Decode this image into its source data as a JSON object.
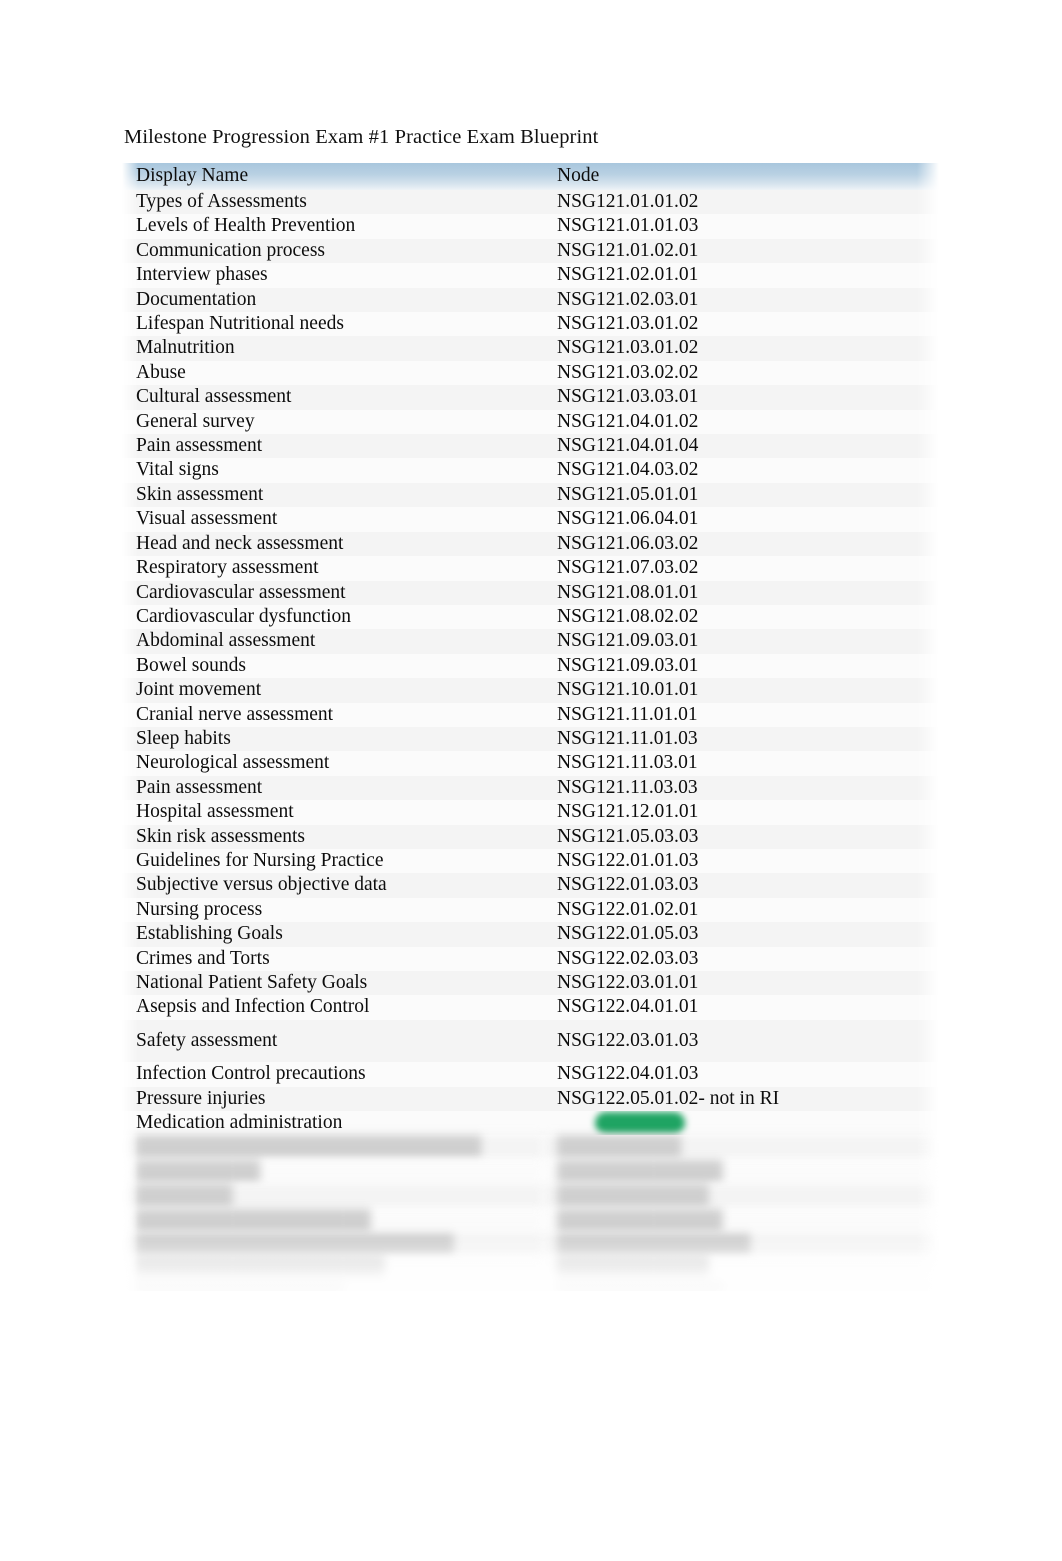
{
  "document": {
    "title": "Milestone Progression Exam #1 Practice Exam Blueprint"
  },
  "table": {
    "columns": [
      "Display Name",
      "Node"
    ],
    "header": {
      "display_name": "Display Name",
      "node": "Node"
    },
    "header_background_color": "#b9d1e3",
    "highlight_color": "#1fa463",
    "rows": [
      {
        "display_name": "Types of Assessments",
        "node": "NSG121.01.01.02",
        "obscured": false
      },
      {
        "display_name": "Levels of Health Prevention",
        "node": "NSG121.01.01.03",
        "obscured": false
      },
      {
        "display_name": "Communication process",
        "node": "NSG121.01.02.01",
        "obscured": false
      },
      {
        "display_name": "Interview phases",
        "node": "NSG121.02.01.01",
        "obscured": false
      },
      {
        "display_name": "Documentation",
        "node": "NSG121.02.03.01",
        "obscured": false
      },
      {
        "display_name": "Lifespan Nutritional needs",
        "node": "NSG121.03.01.02",
        "obscured": false
      },
      {
        "display_name": "Malnutrition",
        "node": "NSG121.03.01.02",
        "obscured": false
      },
      {
        "display_name": "Abuse",
        "node": "NSG121.03.02.02",
        "obscured": false
      },
      {
        "display_name": "Cultural assessment",
        "node": "NSG121.03.03.01",
        "obscured": false
      },
      {
        "display_name": "General survey",
        "node": "NSG121.04.01.02",
        "obscured": false
      },
      {
        "display_name": "Pain assessment",
        "node": "NSG121.04.01.04",
        "obscured": false
      },
      {
        "display_name": "Vital signs",
        "node": "NSG121.04.03.02",
        "obscured": false
      },
      {
        "display_name": "Skin assessment",
        "node": "NSG121.05.01.01",
        "obscured": false
      },
      {
        "display_name": "Visual assessment",
        "node": "NSG121.06.04.01",
        "obscured": false
      },
      {
        "display_name": "Head and neck assessment",
        "node": "NSG121.06.03.02",
        "obscured": false
      },
      {
        "display_name": "Respiratory assessment",
        "node": "NSG121.07.03.02",
        "obscured": false
      },
      {
        "display_name": "Cardiovascular assessment",
        "node": "NSG121.08.01.01",
        "obscured": false
      },
      {
        "display_name": "Cardiovascular dysfunction",
        "node": "NSG121.08.02.02",
        "obscured": false
      },
      {
        "display_name": "Abdominal assessment",
        "node": "NSG121.09.03.01",
        "obscured": false
      },
      {
        "display_name": "Bowel sounds",
        "node": "NSG121.09.03.01",
        "obscured": false
      },
      {
        "display_name": "Joint movement",
        "node": "NSG121.10.01.01",
        "obscured": false
      },
      {
        "display_name": "Cranial nerve assessment",
        "node": "NSG121.11.01.01",
        "obscured": false
      },
      {
        "display_name": "Sleep habits",
        "node": "NSG121.11.01.03",
        "obscured": false
      },
      {
        "display_name": "Neurological assessment",
        "node": "NSG121.11.03.01",
        "obscured": false
      },
      {
        "display_name": "Pain assessment",
        "node": "NSG121.11.03.03",
        "obscured": false
      },
      {
        "display_name": "Hospital assessment",
        "node": "NSG121.12.01.01",
        "obscured": false
      },
      {
        "display_name": "Skin risk assessments",
        "node": "NSG121.05.03.03",
        "obscured": false
      },
      {
        "display_name": "Guidelines for Nursing Practice",
        "node": "NSG122.01.01.03",
        "obscured": false
      },
      {
        "display_name": "Subjective versus objective data",
        "node": "NSG122.01.03.03",
        "obscured": false
      },
      {
        "display_name": "Nursing process",
        "node": "NSG122.01.02.01",
        "obscured": false
      },
      {
        "display_name": "Establishing Goals",
        "node": "NSG122.01.05.03",
        "obscured": false
      },
      {
        "display_name": "Crimes and Torts",
        "node": "NSG122.02.03.03",
        "obscured": false
      },
      {
        "display_name": "National Patient Safety Goals",
        "node": "NSG122.03.01.01",
        "obscured": false
      },
      {
        "display_name": "Asepsis and Infection Control",
        "node": "NSG122.04.01.01",
        "obscured": false
      },
      {
        "display_name": "Safety assessment",
        "node": "NSG122.03.01.03",
        "obscured": false,
        "gap_before": true
      },
      {
        "display_name": "Infection Control precautions",
        "node": "NSG122.04.01.03",
        "obscured": false
      },
      {
        "display_name": "Pressure injuries",
        "node": "NSG122.05.01.02- not in RI",
        "obscured": false
      },
      {
        "display_name": "Medication administration",
        "node": "",
        "obscured": false,
        "highlight": true
      },
      {
        "display_name": "",
        "node": "",
        "obscured": true
      },
      {
        "display_name": "",
        "node": "",
        "obscured": true
      },
      {
        "display_name": "",
        "node": "",
        "obscured": true
      },
      {
        "display_name": "",
        "node": "",
        "obscured": true
      },
      {
        "display_name": "",
        "node": "",
        "obscured": true
      },
      {
        "display_name": "",
        "node": "",
        "obscured": true
      },
      {
        "display_name": "",
        "node": "",
        "obscured": true
      },
      {
        "display_name": "",
        "node": "",
        "obscured": true
      }
    ]
  }
}
